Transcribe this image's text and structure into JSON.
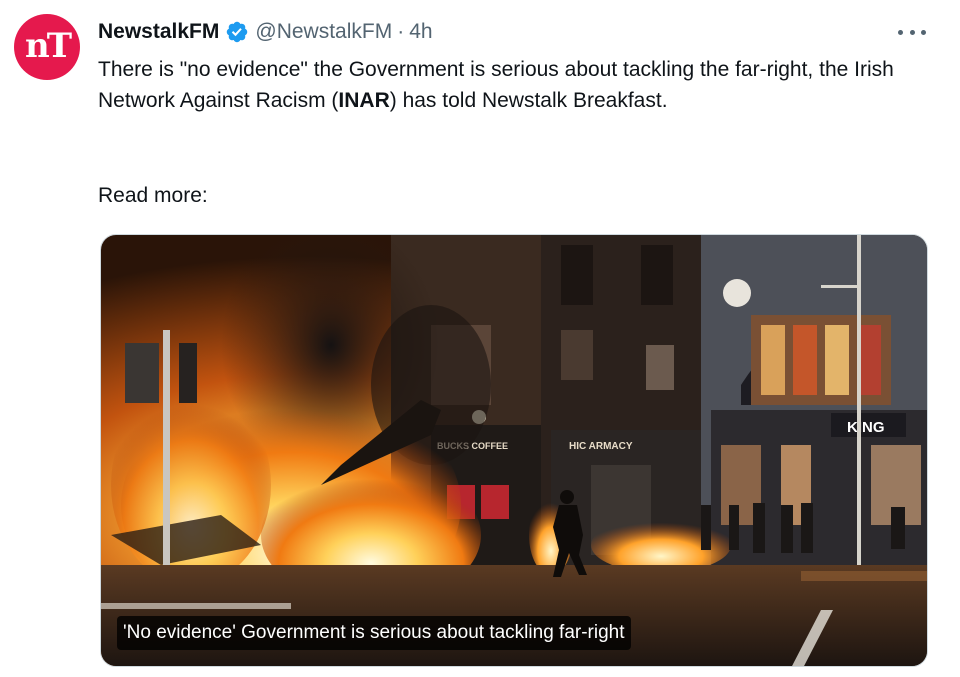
{
  "author": {
    "avatar_text": "nT",
    "display_name": "NewstalkFM",
    "verified": true,
    "handle": "@NewstalkFM",
    "separator": "·",
    "time": "4h",
    "brand_color": "#e5194d"
  },
  "tweet": {
    "text_part1": "There is \"no evidence\" the Government is serious about tackling the far-right, the Irish Network Against Racism (",
    "text_bold": "INAR",
    "text_part2": ") has told Newstalk Breakfast.",
    "read_more": "Read more:"
  },
  "media": {
    "caption": "'No evidence' Government is serious about tackling far-right",
    "sign_starbucks": "BUCKS COFFEE",
    "sign_pharmacy": "HIC   ARMACY",
    "sign_king": "KING"
  },
  "icons": {
    "verified": "verified-badge-icon",
    "more": "more-options-icon"
  },
  "colors": {
    "verified": "#1d9bf0",
    "text_primary": "#0f1419",
    "text_secondary": "#536471"
  }
}
